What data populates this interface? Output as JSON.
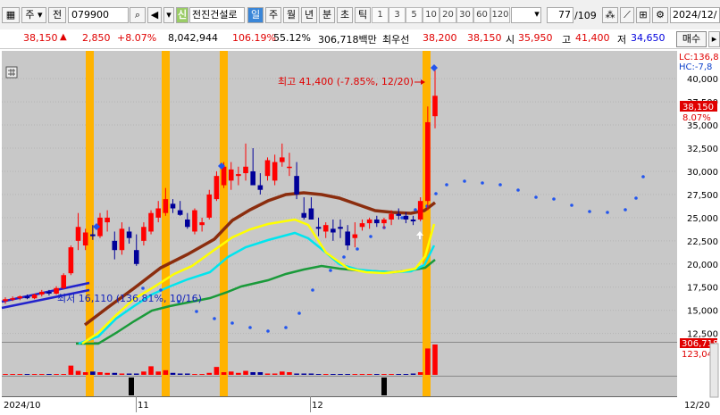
{
  "toolbar": {
    "mode": "주",
    "market": "전",
    "code": "079900",
    "badge": "신",
    "name": "전진건설로",
    "periods": [
      "일",
      "주",
      "월",
      "년",
      "분",
      "초",
      "틱"
    ],
    "active_period": "일",
    "intervals": [
      "1",
      "3",
      "5",
      "10",
      "20",
      "30",
      "60",
      "120"
    ],
    "count": "77",
    "count_total": "/109",
    "date": "2024/12/"
  },
  "quote": {
    "price": "38,150",
    "change": "2,850",
    "change_pct": "+8.07%",
    "volume": "8,042,944",
    "vol_ratio": "106.19%",
    "turnover": "55.12%",
    "amount": "306,718백만",
    "best_label": "최우선",
    "best_ask": "38,200",
    "best_bid": "38,150",
    "open_label": "시",
    "open": "35,950",
    "high_label": "고",
    "high": "41,400",
    "low_label": "저",
    "low": "34,650",
    "buy_btn": "매수"
  },
  "chart": {
    "lc_label": "LC:136,8",
    "hc_label": "HC:-7,8",
    "high_annotation": "최고 41,400 (-7.85%, 12/20)",
    "low_annotation": "최저 16,110 (136.81%, 10/16)",
    "current_price_tag": "38,150",
    "current_pct_tag": "8.07%",
    "volume_tag": "306,718",
    "volume_tag2": "123,043",
    "date_labels": [
      "2024/10",
      "11",
      "12",
      "12/20"
    ],
    "colors": {
      "up": "#ff0000",
      "down": "#000099",
      "ma_brown": "#8b2d0e",
      "ma_yellow": "#ffff00",
      "ma_cyan": "#00e5ee",
      "ma_green": "#1a9a3a",
      "parabolic": "#2255ee",
      "highlight": "#ffb300"
    }
  },
  "chart_data": {
    "type": "candlestick",
    "y_ticks": [
      12500,
      15000,
      17500,
      20000,
      22500,
      25000,
      27500,
      30000,
      32500,
      35000,
      37500,
      40000
    ],
    "ylim": [
      11600,
      43000
    ],
    "candles": [
      [
        16000,
        16400,
        15700,
        16200
      ],
      [
        16200,
        16500,
        16000,
        16300
      ],
      [
        16300,
        16600,
        16100,
        16500
      ],
      [
        16500,
        16700,
        16200,
        16300
      ],
      [
        16300,
        16800,
        16200,
        16700
      ],
      [
        16700,
        17200,
        16500,
        17000
      ],
      [
        17000,
        17200,
        16600,
        16800
      ],
      [
        16800,
        17600,
        16700,
        17400
      ],
      [
        17400,
        19000,
        17300,
        18800
      ],
      [
        19000,
        22000,
        18800,
        21800
      ],
      [
        22500,
        25500,
        21500,
        24000
      ],
      [
        22000,
        23800,
        21500,
        23400
      ],
      [
        23200,
        24200,
        22600,
        23000
      ],
      [
        23000,
        25500,
        22800,
        25000
      ],
      [
        24500,
        25800,
        23500,
        25000
      ],
      [
        22500,
        23500,
        20500,
        21500
      ],
      [
        21500,
        24500,
        21000,
        23800
      ],
      [
        23500,
        24000,
        22200,
        22800
      ],
      [
        21500,
        23200,
        19800,
        20000
      ],
      [
        22500,
        24500,
        22000,
        24000
      ],
      [
        23500,
        25800,
        23200,
        25500
      ],
      [
        25000,
        26800,
        24500,
        26000
      ],
      [
        25500,
        28200,
        25200,
        27000
      ],
      [
        26500,
        27000,
        25500,
        26000
      ],
      [
        25800,
        26800,
        25200,
        25300
      ],
      [
        24800,
        25500,
        23800,
        24000
      ],
      [
        23500,
        26000,
        23200,
        25800
      ],
      [
        24200,
        25000,
        23500,
        24500
      ],
      [
        25000,
        28000,
        24800,
        27500
      ],
      [
        27000,
        30000,
        26800,
        29500
      ],
      [
        28500,
        31000,
        28200,
        30500
      ],
      [
        29000,
        31000,
        28000,
        30200
      ],
      [
        29500,
        30500,
        28500,
        29700
      ],
      [
        29800,
        33000,
        29000,
        30500
      ],
      [
        30000,
        32500,
        29500,
        28500
      ],
      [
        28500,
        29800,
        27500,
        28000
      ],
      [
        29500,
        31500,
        29000,
        31200
      ],
      [
        29000,
        31800,
        28500,
        31000
      ],
      [
        31000,
        33000,
        30500,
        31500
      ],
      [
        30500,
        32000,
        29500,
        30500
      ],
      [
        29500,
        31000,
        27000,
        27500
      ],
      [
        25500,
        27200,
        24800,
        25000
      ],
      [
        26000,
        27200,
        24800,
        24800
      ],
      [
        24000,
        25000,
        23000,
        23800
      ],
      [
        23500,
        24500,
        22800,
        24200
      ],
      [
        23800,
        24800,
        22500,
        23400
      ],
      [
        24000,
        24800,
        22800,
        23800
      ],
      [
        23500,
        24200,
        21500,
        22000
      ],
      [
        22800,
        24500,
        21800,
        23200
      ],
      [
        24000,
        24800,
        23600,
        24400
      ],
      [
        24400,
        25000,
        23800,
        24800
      ],
      [
        24800,
        25200,
        24000,
        24400
      ],
      [
        24400,
        25000,
        23800,
        24800
      ],
      [
        24800,
        25800,
        24200,
        25400
      ],
      [
        25400,
        26000,
        24800,
        25200
      ],
      [
        25200,
        25600,
        24400,
        24800
      ],
      [
        24800,
        25200,
        24200,
        24600
      ],
      [
        24800,
        27200,
        24600,
        26800
      ],
      [
        26800,
        37000,
        25800,
        35300
      ],
      [
        35950,
        41400,
        34650,
        38150
      ]
    ],
    "volume": [
      1,
      1,
      1,
      1,
      1,
      1,
      1,
      1,
      1,
      14,
      6,
      4,
      5,
      4,
      3,
      3,
      2,
      2,
      2,
      5,
      13,
      5,
      7,
      3,
      2,
      2,
      1,
      1,
      3,
      12,
      4,
      5,
      3,
      6,
      4,
      4,
      2,
      2,
      5,
      4,
      2,
      2,
      2,
      1,
      1,
      1,
      1,
      1,
      1,
      1,
      1,
      1,
      1,
      1,
      1,
      1,
      2,
      4,
      40,
      46
    ],
    "ma_brown": [
      [
        95,
        309
      ],
      [
        120,
        290
      ],
      [
        150,
        268
      ],
      [
        180,
        245
      ],
      [
        210,
        230
      ],
      [
        240,
        213
      ],
      [
        260,
        192
      ],
      [
        280,
        180
      ],
      [
        300,
        170
      ],
      [
        320,
        163
      ],
      [
        340,
        161
      ],
      [
        360,
        163
      ],
      [
        380,
        167
      ],
      [
        400,
        174
      ],
      [
        420,
        181
      ],
      [
        440,
        183
      ],
      [
        460,
        184
      ],
      [
        475,
        181
      ],
      [
        487,
        172
      ]
    ],
    "ma_yellow": [
      [
        92,
        330
      ],
      [
        110,
        318
      ],
      [
        130,
        298
      ],
      [
        150,
        280
      ],
      [
        170,
        268
      ],
      [
        195,
        252
      ],
      [
        215,
        243
      ],
      [
        240,
        225
      ],
      [
        260,
        211
      ],
      [
        280,
        202
      ],
      [
        300,
        196
      ],
      [
        330,
        191
      ],
      [
        345,
        197
      ],
      [
        365,
        228
      ],
      [
        390,
        246
      ],
      [
        410,
        250
      ],
      [
        430,
        251
      ],
      [
        450,
        249
      ],
      [
        465,
        246
      ],
      [
        476,
        232
      ],
      [
        486,
        196
      ]
    ],
    "ma_cyan": [
      [
        88,
        330
      ],
      [
        110,
        322
      ],
      [
        130,
        302
      ],
      [
        150,
        288
      ],
      [
        170,
        275
      ],
      [
        190,
        266
      ],
      [
        210,
        258
      ],
      [
        235,
        250
      ],
      [
        255,
        233
      ],
      [
        275,
        222
      ],
      [
        300,
        214
      ],
      [
        330,
        206
      ],
      [
        345,
        212
      ],
      [
        360,
        224
      ],
      [
        380,
        241
      ],
      [
        400,
        247
      ],
      [
        420,
        249
      ],
      [
        440,
        250
      ],
      [
        460,
        249
      ],
      [
        475,
        242
      ],
      [
        486,
        220
      ]
    ],
    "ma_green": [
      [
        85,
        330
      ],
      [
        110,
        330
      ],
      [
        130,
        318
      ],
      [
        150,
        305
      ],
      [
        170,
        293
      ],
      [
        190,
        288
      ],
      [
        210,
        284
      ],
      [
        235,
        279
      ],
      [
        255,
        272
      ],
      [
        270,
        266
      ],
      [
        300,
        259
      ],
      [
        320,
        252
      ],
      [
        340,
        247
      ],
      [
        360,
        243
      ],
      [
        380,
        246
      ],
      [
        400,
        248
      ],
      [
        420,
        249
      ],
      [
        440,
        250
      ],
      [
        460,
        248
      ],
      [
        476,
        245
      ],
      [
        487,
        236
      ]
    ],
    "parabolic": [
      [
        160,
        268
      ],
      [
        180,
        270
      ],
      [
        200,
        283
      ],
      [
        220,
        294
      ],
      [
        240,
        302
      ],
      [
        260,
        307
      ],
      [
        280,
        312
      ],
      [
        300,
        316
      ],
      [
        320,
        312
      ],
      [
        335,
        296
      ],
      [
        350,
        270
      ],
      [
        370,
        248
      ],
      [
        385,
        233
      ],
      [
        400,
        224
      ],
      [
        415,
        210
      ],
      [
        430,
        200
      ],
      [
        450,
        189
      ],
      [
        465,
        180
      ],
      [
        478,
        176
      ],
      [
        488,
        162
      ],
      [
        500,
        152
      ],
      [
        520,
        148
      ],
      [
        540,
        150
      ],
      [
        560,
        152
      ],
      [
        580,
        158
      ],
      [
        600,
        166
      ],
      [
        620,
        168
      ],
      [
        640,
        175
      ],
      [
        660,
        182
      ],
      [
        680,
        183
      ],
      [
        700,
        180
      ],
      [
        712,
        167
      ],
      [
        720,
        143
      ]
    ],
    "highlights_x": [
      100,
      185,
      250,
      477
    ],
    "volume_bars_black_x": [
      147,
      430
    ]
  }
}
